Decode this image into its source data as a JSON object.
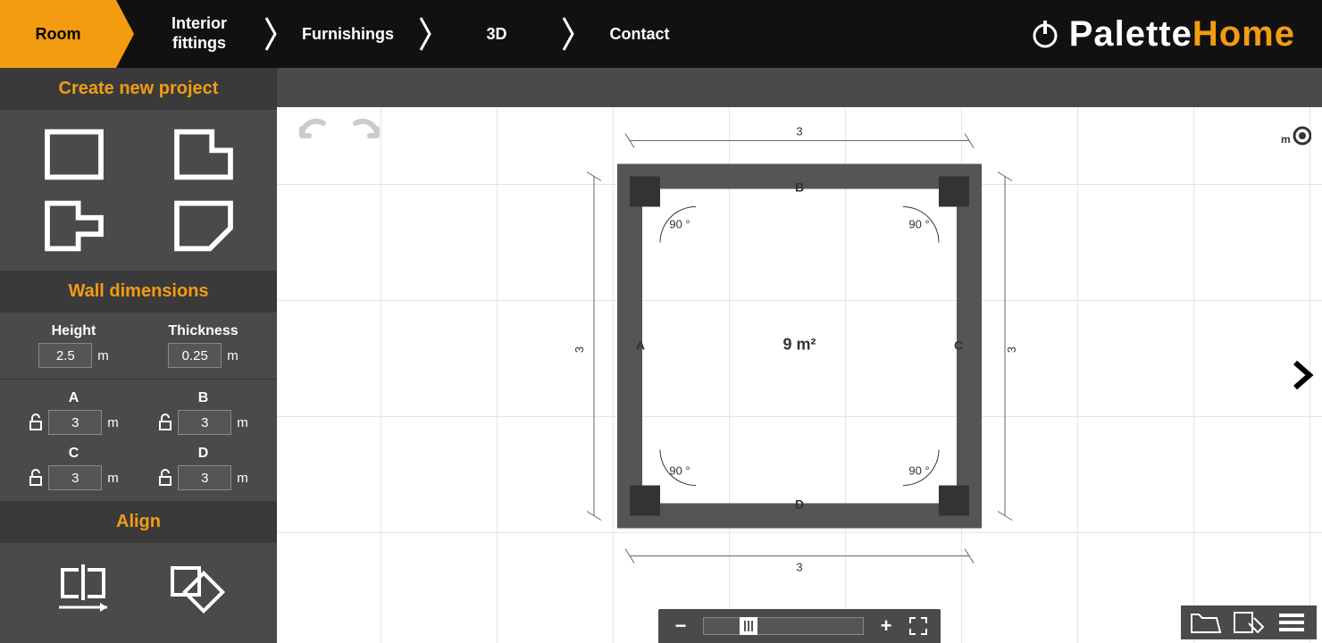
{
  "header": {
    "nav": {
      "room": "Room",
      "interior_line1": "Interior",
      "interior_line2": "fittings",
      "furnishings": "Furnishings",
      "threeD": "3D",
      "contact": "Contact"
    },
    "logo": {
      "part1": "Palette",
      "part2": "Home"
    }
  },
  "sidebar": {
    "create_label": "Create new project",
    "wall_dim_label": "Wall dimensions",
    "align_label": "Align",
    "height_label": "Height",
    "thickness_label": "Thickness",
    "height_value": "2.5",
    "thickness_value": "0.25",
    "unit": "m",
    "walls": {
      "A": {
        "label": "A",
        "value": "3"
      },
      "B": {
        "label": "B",
        "value": "3"
      },
      "C": {
        "label": "C",
        "value": "3"
      },
      "D": {
        "label": "D",
        "value": "3"
      }
    }
  },
  "canvas": {
    "area": "9 m²",
    "angle": "90 °",
    "dim_top": "3",
    "dim_bottom": "3",
    "dim_left": "3",
    "dim_right": "3",
    "wall_A": "A",
    "wall_B": "B",
    "wall_C": "C",
    "wall_D": "D"
  }
}
